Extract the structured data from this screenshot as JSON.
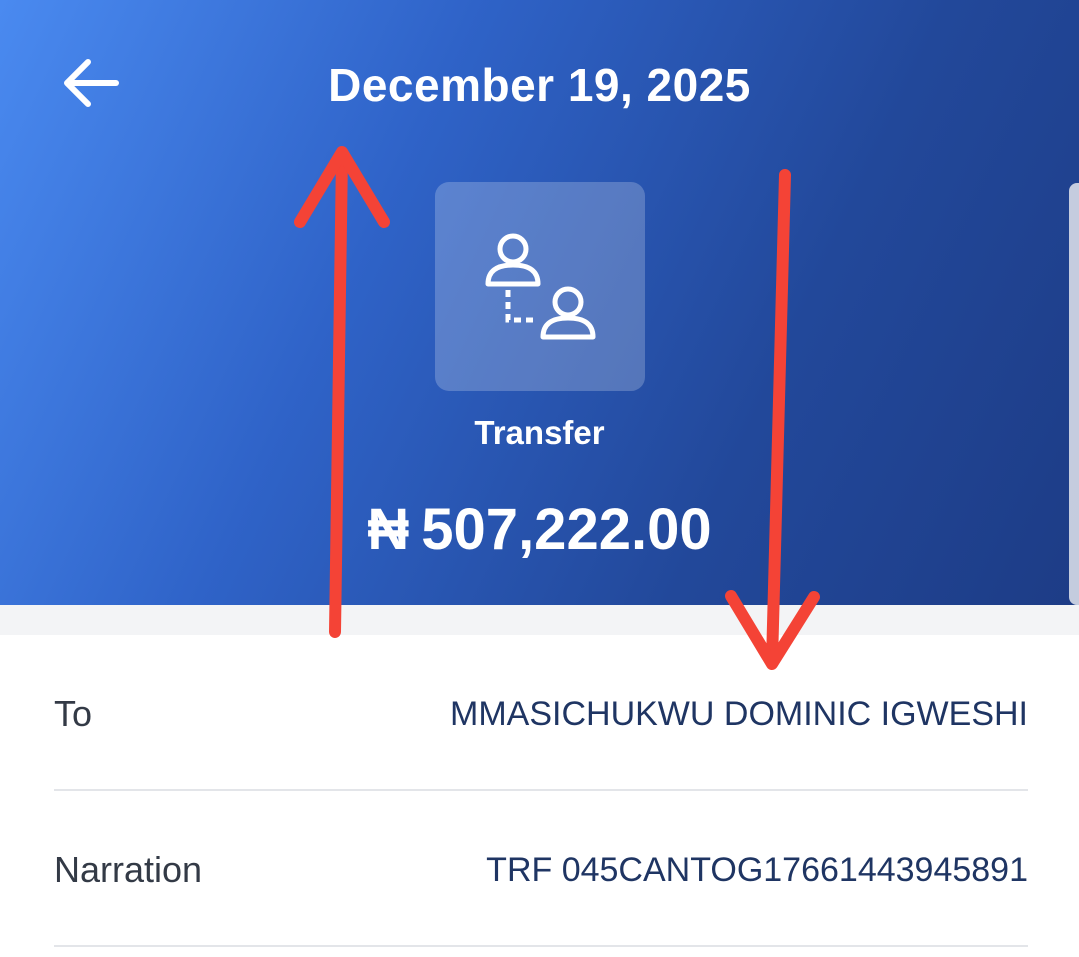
{
  "header": {
    "title": "December 19, 2025",
    "back_icon": "arrow-left-icon"
  },
  "transaction": {
    "icon": "transfer-users-icon",
    "type_label": "Transfer",
    "currency_symbol": "₦",
    "amount": "507,222.00"
  },
  "details": [
    {
      "label": "To",
      "value": "MMASICHUKWU DOMINIC IGWESHI"
    },
    {
      "label": "Narration",
      "value": "TRF 045CANTOG17661443945891"
    }
  ],
  "colors": {
    "header_gradient_start": "#4a8af0",
    "header_gradient_end": "#1d3c86",
    "value_text": "#1f3563",
    "annotation_arrow": "#f44336"
  }
}
